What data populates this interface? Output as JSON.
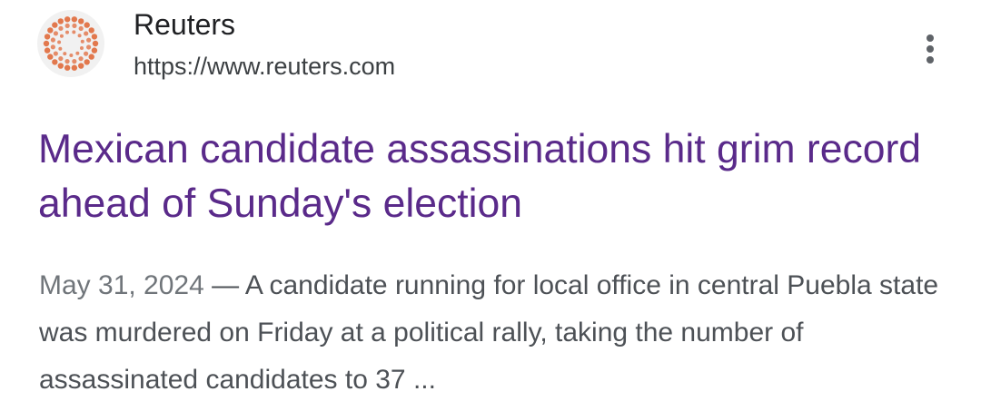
{
  "source": {
    "name": "Reuters",
    "url": "https://www.reuters.com",
    "favicon_icon": "reuters-dotted-logo-icon",
    "favicon_color": "#e06a3b"
  },
  "result": {
    "title": "Mexican candidate assassinations hit grim record ahead of Sunday's election",
    "date": "May 31, 2024",
    "separator": " — ",
    "snippet": "A candidate running for local office in central Puebla state was murdered on Friday at a political rally, taking the number of assassinated candidates to 37 ...",
    "title_color": "#5a2a8a"
  },
  "menu": {
    "icon": "more-vert-icon"
  }
}
